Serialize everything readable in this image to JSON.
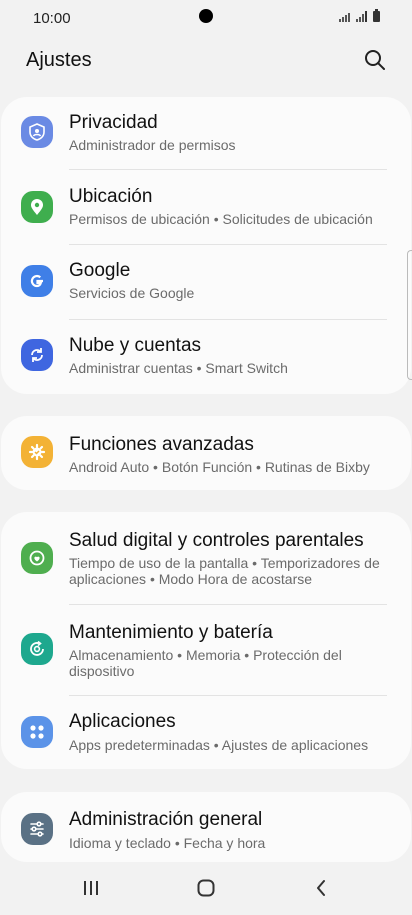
{
  "status": {
    "time": "10:00"
  },
  "header": {
    "title": "Ajustes"
  },
  "cards": [
    {
      "items": [
        {
          "title": "Privacidad",
          "subtitle": "Administrador de permisos",
          "icon": "privacy-shield-icon",
          "color": "#5b7fe1"
        },
        {
          "title": "Ubicación",
          "subtitle": "Permisos de ubicación  •  Solicitudes de ubicación",
          "icon": "location-pin-icon",
          "color": "#3fae4e"
        },
        {
          "title": "Google",
          "subtitle": "Servicios de Google",
          "icon": "google-icon",
          "color": "#3f7fe7"
        },
        {
          "title": "Nube y cuentas",
          "subtitle": "Administrar cuentas  •  Smart Switch",
          "icon": "sync-icon",
          "color": "#3f66e0"
        }
      ]
    },
    {
      "items": [
        {
          "title": "Funciones avanzadas",
          "subtitle": "Android Auto  •  Botón Función  •  Rutinas de Bixby",
          "icon": "advanced-features-icon",
          "color": "#f3b235"
        }
      ]
    },
    {
      "items": [
        {
          "title": "Salud digital y controles parentales",
          "subtitle": "Tiempo de uso de la pantalla  •  Temporizadores de aplicaciones  •  Modo Hora de acostarse",
          "icon": "digital-wellbeing-icon",
          "color": "#4fae4f"
        },
        {
          "title": "Mantenimiento y batería",
          "subtitle": "Almacenamiento  •  Memoria  •  Protección del dispositivo",
          "icon": "device-care-icon",
          "color": "#1ea88e"
        },
        {
          "title": "Aplicaciones",
          "subtitle": "Apps predeterminadas  •  Ajustes de aplicaciones",
          "icon": "apps-grid-icon",
          "color": "#5b93e8"
        }
      ]
    },
    {
      "items": [
        {
          "title": "Administración general",
          "subtitle": "Idioma y teclado  •  Fecha y hora",
          "icon": "sliders-icon",
          "color": "#5a7185"
        }
      ]
    }
  ]
}
